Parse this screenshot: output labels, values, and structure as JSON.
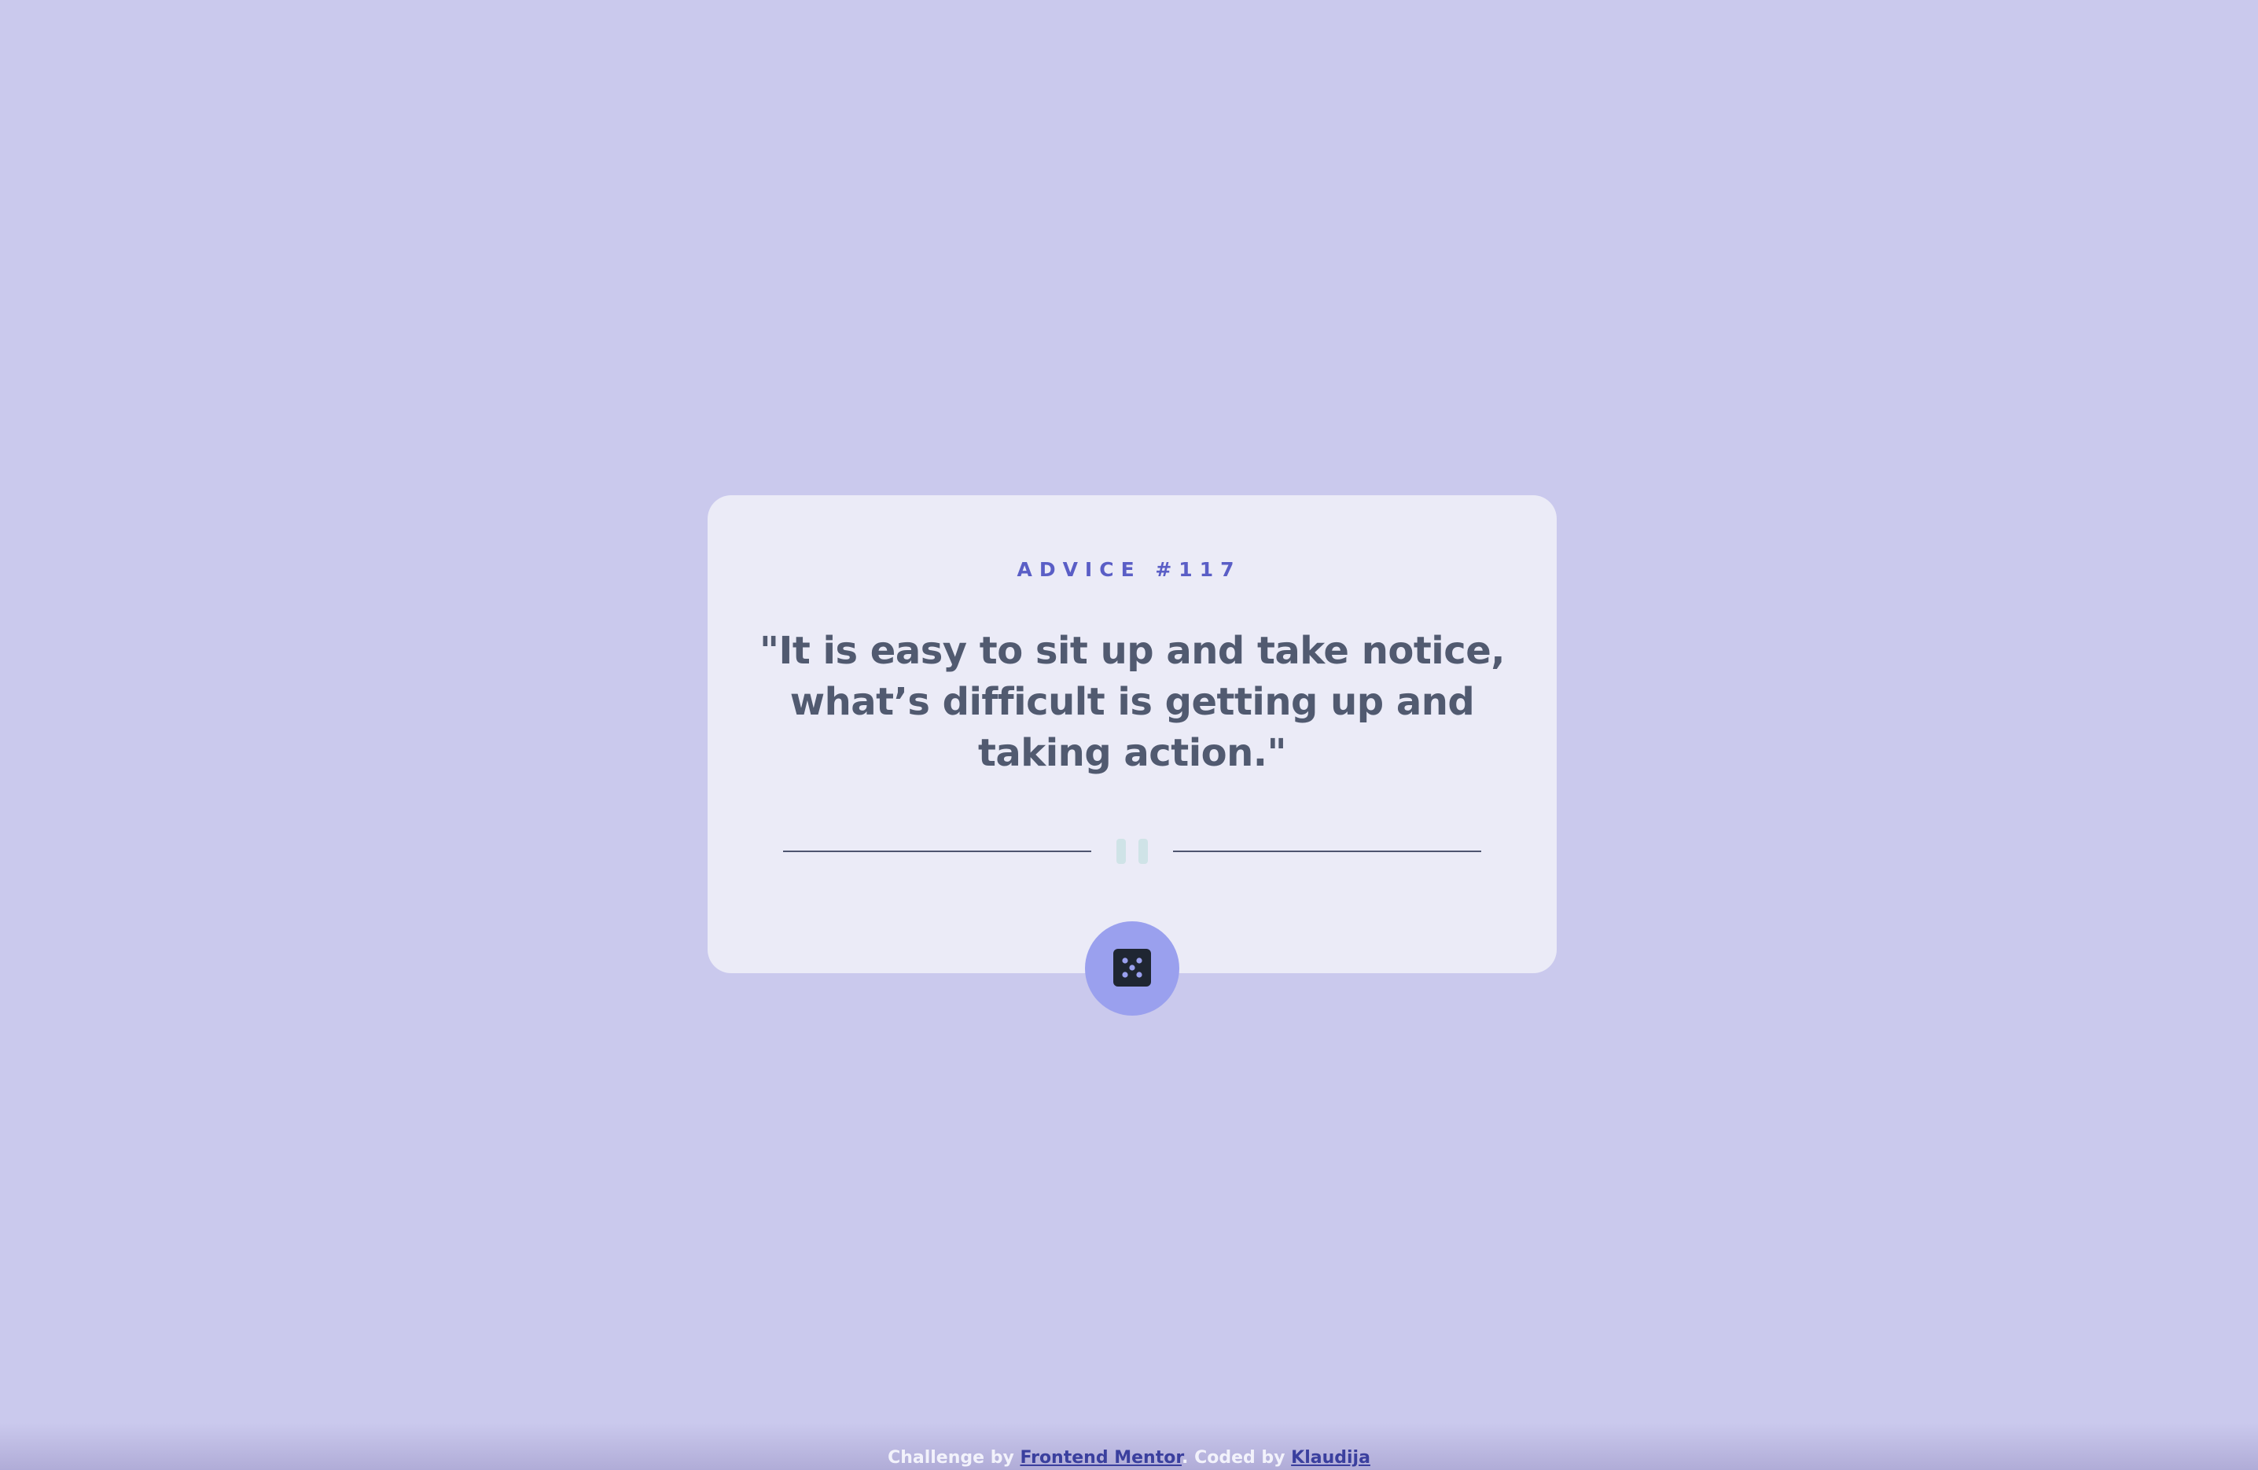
{
  "card": {
    "advice_id": "ADVICE #117",
    "quote": "\"It is easy to sit up and take notice, what’s difficult is getting up and taking action.\""
  },
  "divider": {
    "icon": "pause-icon"
  },
  "dice_button": {
    "icon": "dice-icon"
  },
  "footer": {
    "prefix": "Challenge by ",
    "challenge_link": "Frontend Mentor",
    "middle": ". Coded by ",
    "author_link": "Klaudija"
  },
  "colors": {
    "background": "#cac9ed",
    "card": "#ebebf7",
    "accent": "#5a5ec6",
    "quote_text": "#515a70",
    "button": "#9aa0ee",
    "pause_icon": "#cfe3e7"
  }
}
